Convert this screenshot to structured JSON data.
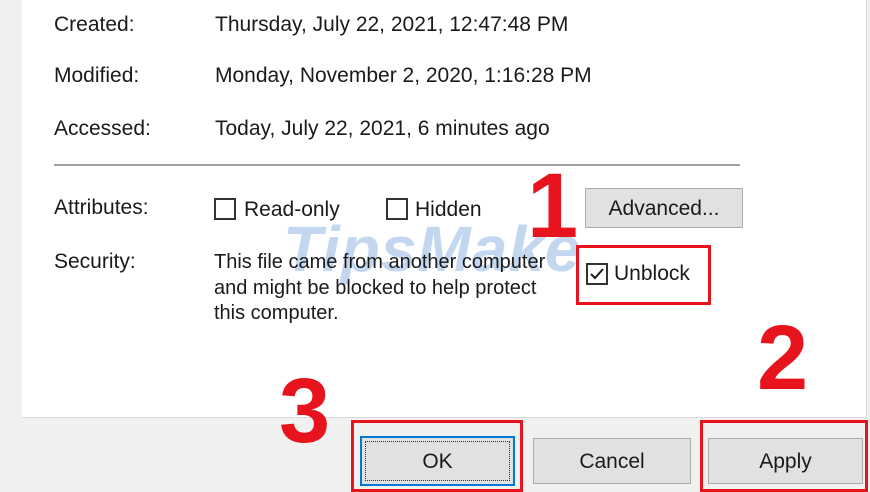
{
  "details": {
    "created_label": "Created:",
    "created_value": "Thursday, July 22, 2021, 12:47:48 PM",
    "modified_label": "Modified:",
    "modified_value": "Monday, November 2, 2020, 1:16:28 PM",
    "accessed_label": "Accessed:",
    "accessed_value": "Today, July 22, 2021, 6 minutes ago"
  },
  "attributes": {
    "label": "Attributes:",
    "readonly_label": "Read-only",
    "readonly_checked": false,
    "hidden_label": "Hidden",
    "hidden_checked": false,
    "advanced_button": "Advanced..."
  },
  "security": {
    "label": "Security:",
    "message_line1": "This file came from another computer",
    "message_line2": "and might be blocked to help protect",
    "message_line3": "this computer.",
    "unblock_label": "Unblock",
    "unblock_checked": true
  },
  "buttons": {
    "ok": "OK",
    "cancel": "Cancel",
    "apply": "Apply"
  },
  "annotations": {
    "step1": "1",
    "step2": "2",
    "step3": "3",
    "color": "#e8141d"
  },
  "watermark": "TipsMake"
}
